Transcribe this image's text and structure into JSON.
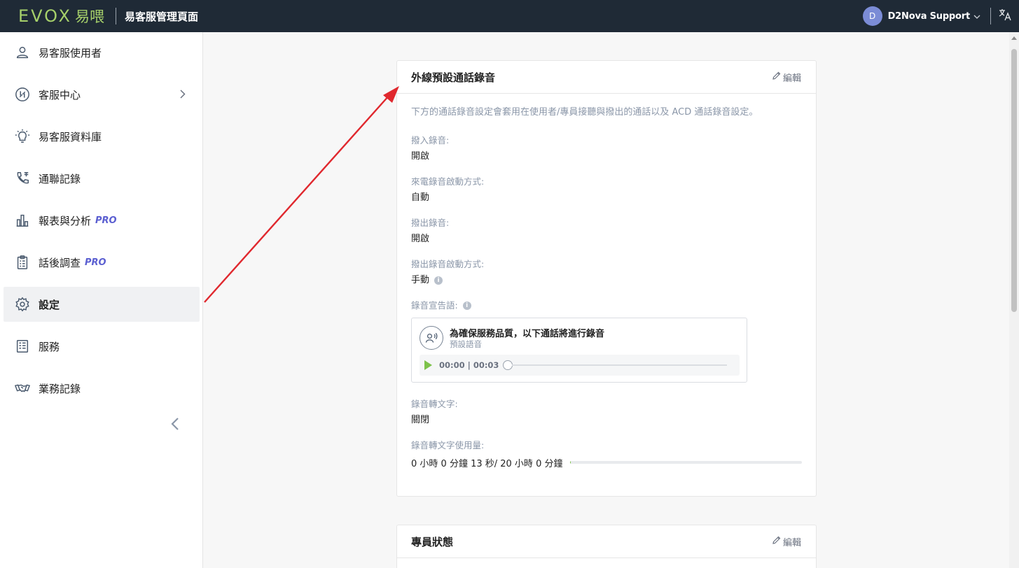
{
  "topbar": {
    "logo_text": "EVOX",
    "logo_cn": "易喂",
    "title": "易客服管理頁面",
    "user_initial": "D",
    "user_name": "D2Nova Support",
    "caret": "⌵",
    "lang_icon": "language-icon"
  },
  "sidebar": {
    "items": [
      {
        "label": "易客服使用者",
        "icon": "user-icon"
      },
      {
        "label": "客服中心",
        "icon": "call-center-icon"
      },
      {
        "label": "易客服資料庫",
        "icon": "lightbulb-icon"
      },
      {
        "label": "通聯記錄",
        "icon": "call-log-icon"
      },
      {
        "label": "報表與分析",
        "icon": "bar-chart-icon",
        "badge": "PRO"
      },
      {
        "label": "話後調查",
        "icon": "survey-clipboard-icon",
        "badge": "PRO"
      },
      {
        "label": "設定",
        "icon": "gear-icon"
      },
      {
        "label": "服務",
        "icon": "service-doc-icon"
      },
      {
        "label": "業務記錄",
        "icon": "handshake-icon"
      }
    ],
    "collapse_glyph": "‹"
  },
  "recording_card": {
    "title": "外線預設通話錄音",
    "edit_label": "編輯",
    "description": "下方的通話錄音設定會套用在使用者/專員接聽與撥出的通話以及 ACD 通話錄音設定。",
    "fields": [
      {
        "label": "撥入錄音:",
        "value": "開啟"
      },
      {
        "label": "來電錄音啟動方式:",
        "value": "自動"
      },
      {
        "label": "撥出錄音:",
        "value": "開啟"
      },
      {
        "label": "撥出錄音啟動方式:",
        "value": "手動"
      }
    ],
    "announcement_label": "錄音宣告語:",
    "announcement": {
      "title": "為確保服務品質，以下通話將進行錄音",
      "subtitle": "預設語音",
      "time": "00:00 | 00:03"
    },
    "transcription_label": "錄音轉文字:",
    "transcription_value": "關閉",
    "usage_label": "錄音轉文字使用量:",
    "usage_text": "0 小時 0 分鐘 13 秒/ 20 小時 0 分鐘",
    "usage_fraction": 0.0002
  },
  "agent_card": {
    "title": "專員狀態",
    "edit_label": "編輯"
  },
  "colors": {
    "topbar_bg": "#1f2a36",
    "brand_green": "#a6d06a",
    "pro_purple": "#5b5fd1",
    "play_green": "#7dc24a",
    "annotation_arrow": "#e0282e"
  }
}
